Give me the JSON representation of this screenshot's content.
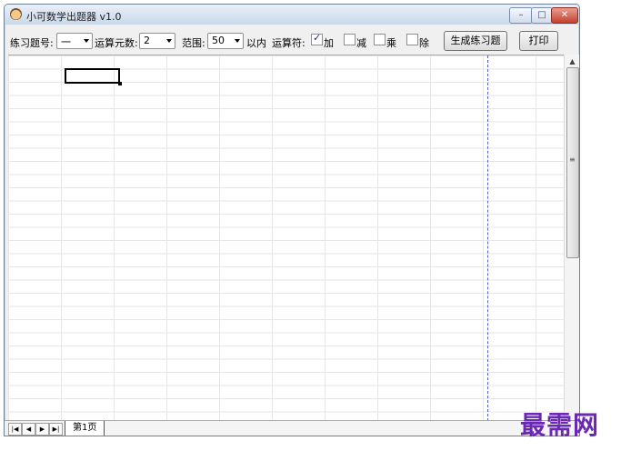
{
  "window": {
    "title": "小可数学出题器 v1.0",
    "controls": {
      "minimize": "–",
      "maximize": "□",
      "close": "✕"
    }
  },
  "toolbar": {
    "exercise_label": "练习题号:",
    "exercise_value": "一",
    "operands_label": "运算元数:",
    "operands_value": "2",
    "range_label": "范围:",
    "range_value": "50",
    "range_suffix": "以内",
    "operators_label": "运算符:",
    "operators": [
      {
        "label": "加",
        "checked": true
      },
      {
        "label": "减",
        "checked": false
      },
      {
        "label": "乘",
        "checked": false
      },
      {
        "label": "除",
        "checked": false
      }
    ],
    "generate_button": "生成练习题",
    "print_button": "打印"
  },
  "sheet": {
    "tabs": [
      {
        "label": "第1页",
        "active": true
      }
    ],
    "nav_icons": [
      "first-icon",
      "prev-icon",
      "next-icon",
      "last-icon"
    ]
  },
  "watermark": "最需网",
  "colors": {
    "page_break": "#5b5bd1",
    "watermark": "#6b28b5",
    "close_button": "#c4402e"
  }
}
